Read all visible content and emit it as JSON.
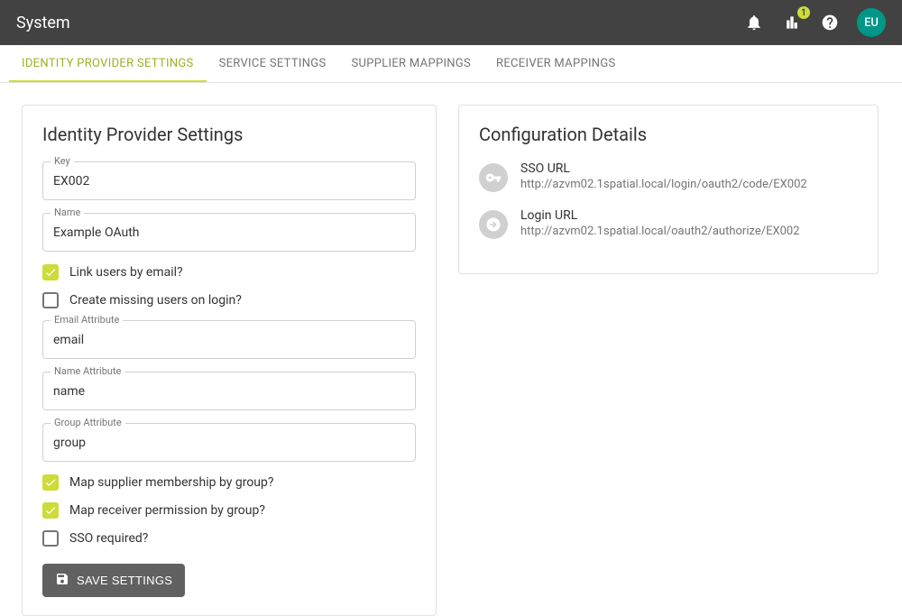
{
  "appbar": {
    "title": "System",
    "badge_count": "1",
    "avatar_initials": "EU"
  },
  "tabs": [
    {
      "label": "IDENTITY PROVIDER SETTINGS",
      "active": true
    },
    {
      "label": "SERVICE SETTINGS",
      "active": false
    },
    {
      "label": "SUPPLIER MAPPINGS",
      "active": false
    },
    {
      "label": "RECEIVER MAPPINGS",
      "active": false
    }
  ],
  "form": {
    "title": "Identity Provider Settings",
    "key_label": "Key",
    "key_value": "EX002",
    "name_label": "Name",
    "name_value": "Example OAuth",
    "link_users_label": "Link users by email?",
    "link_users_checked": true,
    "create_missing_label": "Create missing users on login?",
    "create_missing_checked": false,
    "email_attr_label": "Email Attribute",
    "email_attr_value": "email",
    "name_attr_label": "Name Attribute",
    "name_attr_value": "name",
    "group_attr_label": "Group Attribute",
    "group_attr_value": "group",
    "map_supplier_label": "Map supplier membership by group?",
    "map_supplier_checked": true,
    "map_receiver_label": "Map receiver permission by group?",
    "map_receiver_checked": true,
    "sso_required_label": "SSO required?",
    "sso_required_checked": false,
    "save_label": "SAVE SETTINGS"
  },
  "config": {
    "title": "Configuration Details",
    "sso_label": "SSO URL",
    "sso_value": "http://azvm02.1spatial.local/login/oauth2/code/EX002",
    "login_label": "Login URL",
    "login_value": "http://azvm02.1spatial.local/oauth2/authorize/EX002"
  }
}
